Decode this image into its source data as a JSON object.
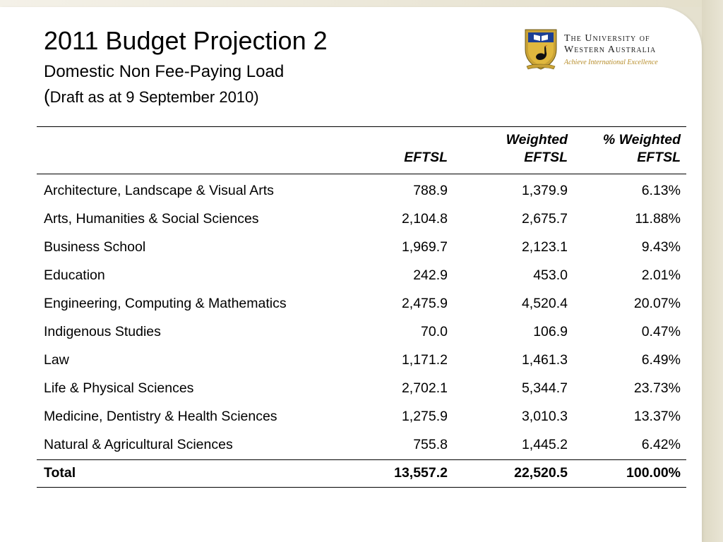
{
  "slide": {
    "title": "2011 Budget Projection 2",
    "subtitle": "Domestic Non Fee-Paying Load",
    "draft_open_paren": "(",
    "draft_text": "Draft as at 9 September 2010)"
  },
  "logo": {
    "name_line1": "The University of",
    "name_line2": "Western Australia",
    "tagline": "Achieve International Excellence",
    "crest_icon": "uwa-crest-icon",
    "colors": {
      "shield_blue": "#1c3f94",
      "gold": "#c9a236",
      "black_swan": "#111111"
    }
  },
  "table": {
    "headers": {
      "col1": "",
      "col2": "EFTSL",
      "col3_line1": "Weighted",
      "col3_line2": "EFTSL",
      "col4_line1": "% Weighted",
      "col4_line2": "EFTSL"
    },
    "rows": [
      {
        "name": "Architecture, Landscape & Visual Arts",
        "eftsl": "788.9",
        "weighted": "1,379.9",
        "pct": "6.13%"
      },
      {
        "name": "Arts, Humanities & Social Sciences",
        "eftsl": "2,104.8",
        "weighted": "2,675.7",
        "pct": "11.88%"
      },
      {
        "name": "Business School",
        "eftsl": "1,969.7",
        "weighted": "2,123.1",
        "pct": "9.43%"
      },
      {
        "name": "Education",
        "eftsl": "242.9",
        "weighted": "453.0",
        "pct": "2.01%"
      },
      {
        "name": "Engineering, Computing & Mathematics",
        "eftsl": "2,475.9",
        "weighted": "4,520.4",
        "pct": "20.07%"
      },
      {
        "name": "Indigenous Studies",
        "eftsl": "70.0",
        "weighted": "106.9",
        "pct": "0.47%"
      },
      {
        "name": "Law",
        "eftsl": "1,171.2",
        "weighted": "1,461.3",
        "pct": "6.49%"
      },
      {
        "name": "Life & Physical Sciences",
        "eftsl": "2,702.1",
        "weighted": "5,344.7",
        "pct": "23.73%"
      },
      {
        "name": "Medicine, Dentistry & Health Sciences",
        "eftsl": "1,275.9",
        "weighted": "3,010.3",
        "pct": "13.37%"
      },
      {
        "name": "Natural & Agricultural Sciences",
        "eftsl": "755.8",
        "weighted": "1,445.2",
        "pct": "6.42%"
      }
    ],
    "total": {
      "name": "Total",
      "eftsl": "13,557.2",
      "weighted": "22,520.5",
      "pct": "100.00%"
    }
  }
}
